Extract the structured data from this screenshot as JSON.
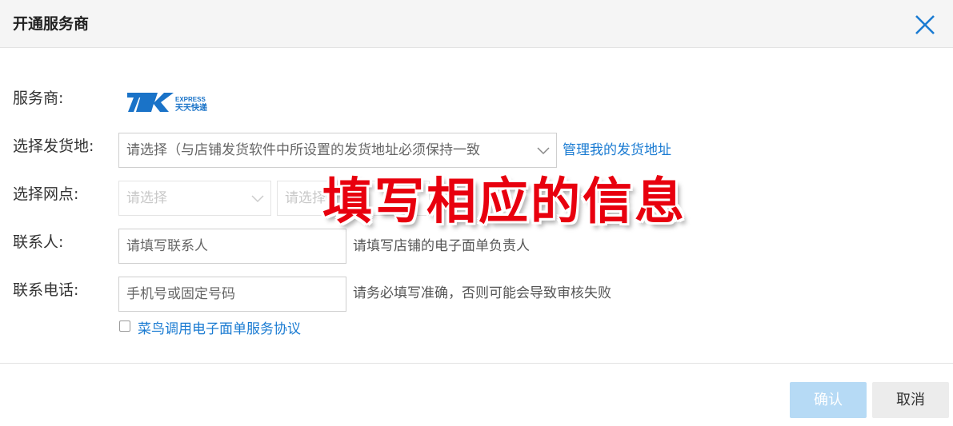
{
  "dialog": {
    "title": "开通服务商",
    "close_icon": "close-icon"
  },
  "form": {
    "provider_label": "服务商:",
    "provider_logo": {
      "text_top": "EXPRESS",
      "text_bottom": "天天快递",
      "brand_color": "#1a73c8"
    },
    "origin_label": "选择发货地:",
    "origin_placeholder": "请选择（与店铺发货软件中所设置的发货地址必须保持一致",
    "origin_link": "管理我的发货地址",
    "outlet_label": "选择网点:",
    "outlet_select1_placeholder": "请选择",
    "outlet_select2_placeholder": "请选择",
    "contact_label": "联系人:",
    "contact_placeholder": "请填写联系人",
    "contact_hint": "请填写店铺的电子面单负责人",
    "phone_label": "联系电话:",
    "phone_placeholder": "手机号或固定号码",
    "phone_hint": "请务必填写准确，否则可能会导致审核失败",
    "agreement_link": "菜鸟调用电子面单服务协议",
    "agreement_checked": false
  },
  "footer": {
    "confirm_label": "确认",
    "cancel_label": "取消"
  },
  "overlay": {
    "text": "填写相应的信息",
    "color": "#e8000e"
  },
  "colors": {
    "link": "#1a7bd2",
    "confirm_bg": "#b6daf5",
    "close_icon": "#1a7bd2"
  }
}
